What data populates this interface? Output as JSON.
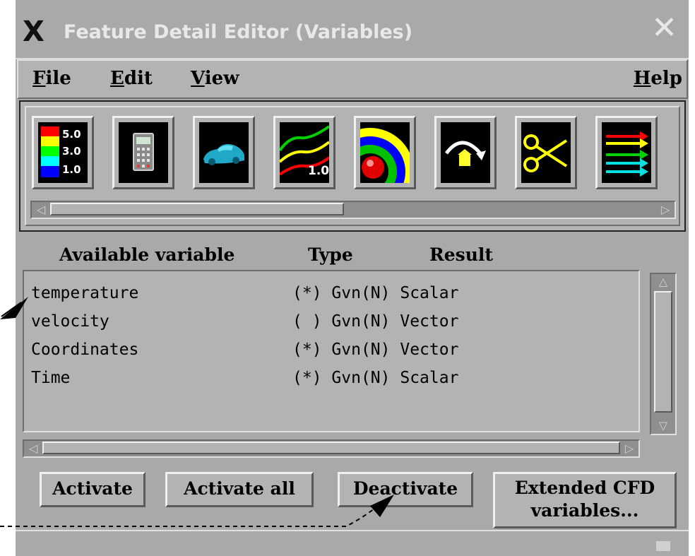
{
  "window": {
    "title": "Feature Detail Editor (Variables)",
    "logo_icon": "x-logo-icon",
    "close_icon": "close-icon"
  },
  "menubar": {
    "file": "File",
    "edit": "Edit",
    "view": "View",
    "help": "Help"
  },
  "toolbar": {
    "tools": [
      {
        "icon": "color-legend-icon",
        "labels": [
          "5.0",
          "3.0",
          "1.0"
        ]
      },
      {
        "icon": "calculator-icon"
      },
      {
        "icon": "car-model-icon"
      },
      {
        "icon": "contour-lines-icon",
        "label": "1.0"
      },
      {
        "icon": "isosurface-icon"
      },
      {
        "icon": "particle-trace-icon"
      },
      {
        "icon": "clip-scissors-icon"
      },
      {
        "icon": "vector-arrows-icon"
      }
    ]
  },
  "columns": {
    "variable": "Available variable",
    "type": "Type",
    "result": "Result"
  },
  "variables": [
    {
      "name": "temperature",
      "active": "(*)",
      "type": "Gvn(N)",
      "result": "Scalar"
    },
    {
      "name": "velocity",
      "active": "( )",
      "type": "Gvn(N)",
      "result": "Vector"
    },
    {
      "name": "Coordinates",
      "active": "(*)",
      "type": "Gvn(N)",
      "result": "Vector"
    },
    {
      "name": "Time",
      "active": "(*)",
      "type": "Gvn(N)",
      "result": "Scalar"
    }
  ],
  "buttons": {
    "activate": "Activate",
    "activate_all": "Activate all",
    "deactivate": "Deactivate",
    "extended_line1": "Extended CFD",
    "extended_line2": "variables..."
  }
}
